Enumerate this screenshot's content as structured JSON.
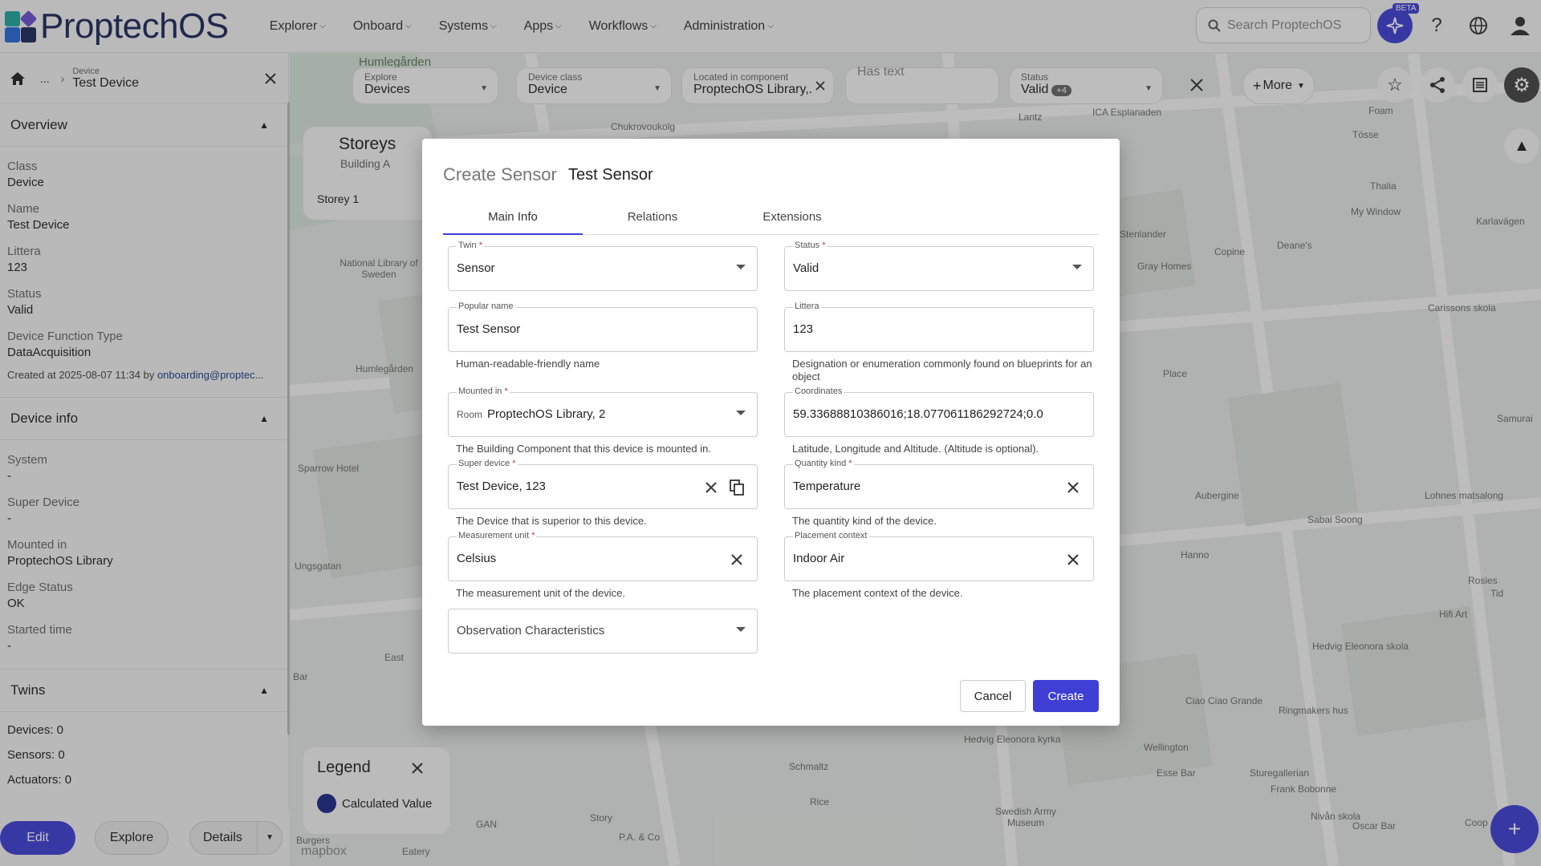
{
  "app": {
    "logo_text": "ProptechOS",
    "nav": [
      "Explorer",
      "Onboard",
      "Systems",
      "Apps",
      "Workflows",
      "Administration"
    ],
    "search_placeholder": "Search ProptechOS",
    "beta_badge": "BETA"
  },
  "sidebar": {
    "crumb_kind": "Device",
    "crumb_title": "Test Device",
    "crumb_ellipsis": "...",
    "overview_title": "Overview",
    "overview_fields": [
      {
        "label": "Class",
        "value": "Device"
      },
      {
        "label": "Name",
        "value": "Test Device"
      },
      {
        "label": "Littera",
        "value": "123"
      },
      {
        "label": "Status",
        "value": "Valid"
      },
      {
        "label": "Device Function Type",
        "value": "DataAcquisition"
      }
    ],
    "created_prefix": "Created at 2025-08-07 11:34 by ",
    "created_by": "onboarding@proptec...",
    "device_info_title": "Device info",
    "device_info_fields": [
      {
        "label": "System",
        "value": "-"
      },
      {
        "label": "Super Device",
        "value": "-"
      },
      {
        "label": "Mounted in",
        "value": "ProptechOS Library"
      },
      {
        "label": "Edge Status",
        "value": "OK"
      },
      {
        "label": "Started time",
        "value": "-"
      }
    ],
    "twins_title": "Twins",
    "twins": [
      "Devices: 0",
      "Sensors: 0",
      "Actuators: 0"
    ],
    "buttons": {
      "edit": "Edit",
      "explore": "Explore",
      "details": "Details"
    }
  },
  "filters": [
    {
      "label": "Explore",
      "value": "Devices"
    },
    {
      "label": "Device class",
      "value": "Device"
    },
    {
      "label": "Located in component",
      "value": "ProptechOS Library,.."
    },
    {
      "label": "",
      "value": "Has text"
    },
    {
      "label": "Status",
      "value": "Valid",
      "badge": "+4"
    }
  ],
  "more_label": "More",
  "storeys": {
    "title": "Storeys",
    "building": "Building A",
    "storey": "Storey 1"
  },
  "legend": {
    "title": "Legend",
    "item": "Calculated Value"
  },
  "map_labels": [
    "Humlegården",
    "Chukrovoukolg",
    "Lantz",
    "ICA Esplanaden",
    "Foam",
    "Tösse",
    "Thalia",
    "My Window",
    "Karlavägen",
    "Stenlander",
    "Copine",
    "Deane's",
    "Gray Homes",
    "Carissons skola",
    "National Library of Sweden",
    "Humlegården",
    "Place",
    "Samurai",
    "Sparrow Hotel",
    "Aubergine",
    "Lohnes matsalong",
    "Sabai Soong",
    "Hanno",
    "Rosies",
    "Tid",
    "Hifi Art",
    "Hedvig Eleonora skola",
    "Ungsgatan",
    "Ciao Ciao Grande",
    "Ringmakers hus",
    "Hedvig Eleonora kyrka",
    "Wellington",
    "Esse Bar",
    "Sturegallerian",
    "Schmaltz",
    "Frank Bobonne",
    "Swedish Army Museum",
    "Story",
    "Rice",
    "Nivån skola",
    "Coop",
    "Oscar Bar",
    "P.A. & Co",
    "Eatery",
    "GAN",
    "Burgers",
    "Bar",
    "East",
    "mapbox"
  ],
  "dialog": {
    "title": "Create Sensor",
    "subtitle": "Test Sensor",
    "tabs": [
      "Main Info",
      "Relations",
      "Extensions"
    ],
    "twin": {
      "label": "Twin",
      "value": "Sensor"
    },
    "status": {
      "label": "Status",
      "value": "Valid"
    },
    "popular_name": {
      "label": "Popular name",
      "value": "Test Sensor",
      "helper": "Human-readable-friendly name"
    },
    "littera": {
      "label": "Littera",
      "value": "123",
      "helper": "Designation or enumeration commonly found on blueprints for an object"
    },
    "mounted_in": {
      "label": "Mounted in",
      "prefix": "Room",
      "value": "ProptechOS Library, 2",
      "helper": "The Building Component that this device is mounted in."
    },
    "coordinates": {
      "label": "Coordinates",
      "value": "59.33688810386016;18.077061186292724;0.0",
      "helper": "Latitude, Longitude and Altitude. (Altitude is optional)."
    },
    "super_device": {
      "label": "Super device",
      "value": "Test Device, 123",
      "helper": "The Device that is superior to this device."
    },
    "quantity_kind": {
      "label": "Quantity kind",
      "value": "Temperature",
      "helper": "The quantity kind of the device."
    },
    "measurement_unit": {
      "label": "Measurement unit",
      "value": "Celsius",
      "helper": "The measurement unit of the device."
    },
    "placement_context": {
      "label": "Placement context",
      "value": "Indoor Air",
      "helper": "The placement context of the device."
    },
    "observation": {
      "placeholder": "Observation Characteristics"
    },
    "required_mark": "*",
    "cancel_label": "Cancel",
    "create_label": "Create"
  },
  "colors": {
    "accent": "#3f3fd6",
    "logo_navy": "#1e2a5a",
    "logo_teal": "#1fa5a0",
    "logo_purple": "#6b4fd0",
    "logo_blue": "#2a6ad8"
  }
}
